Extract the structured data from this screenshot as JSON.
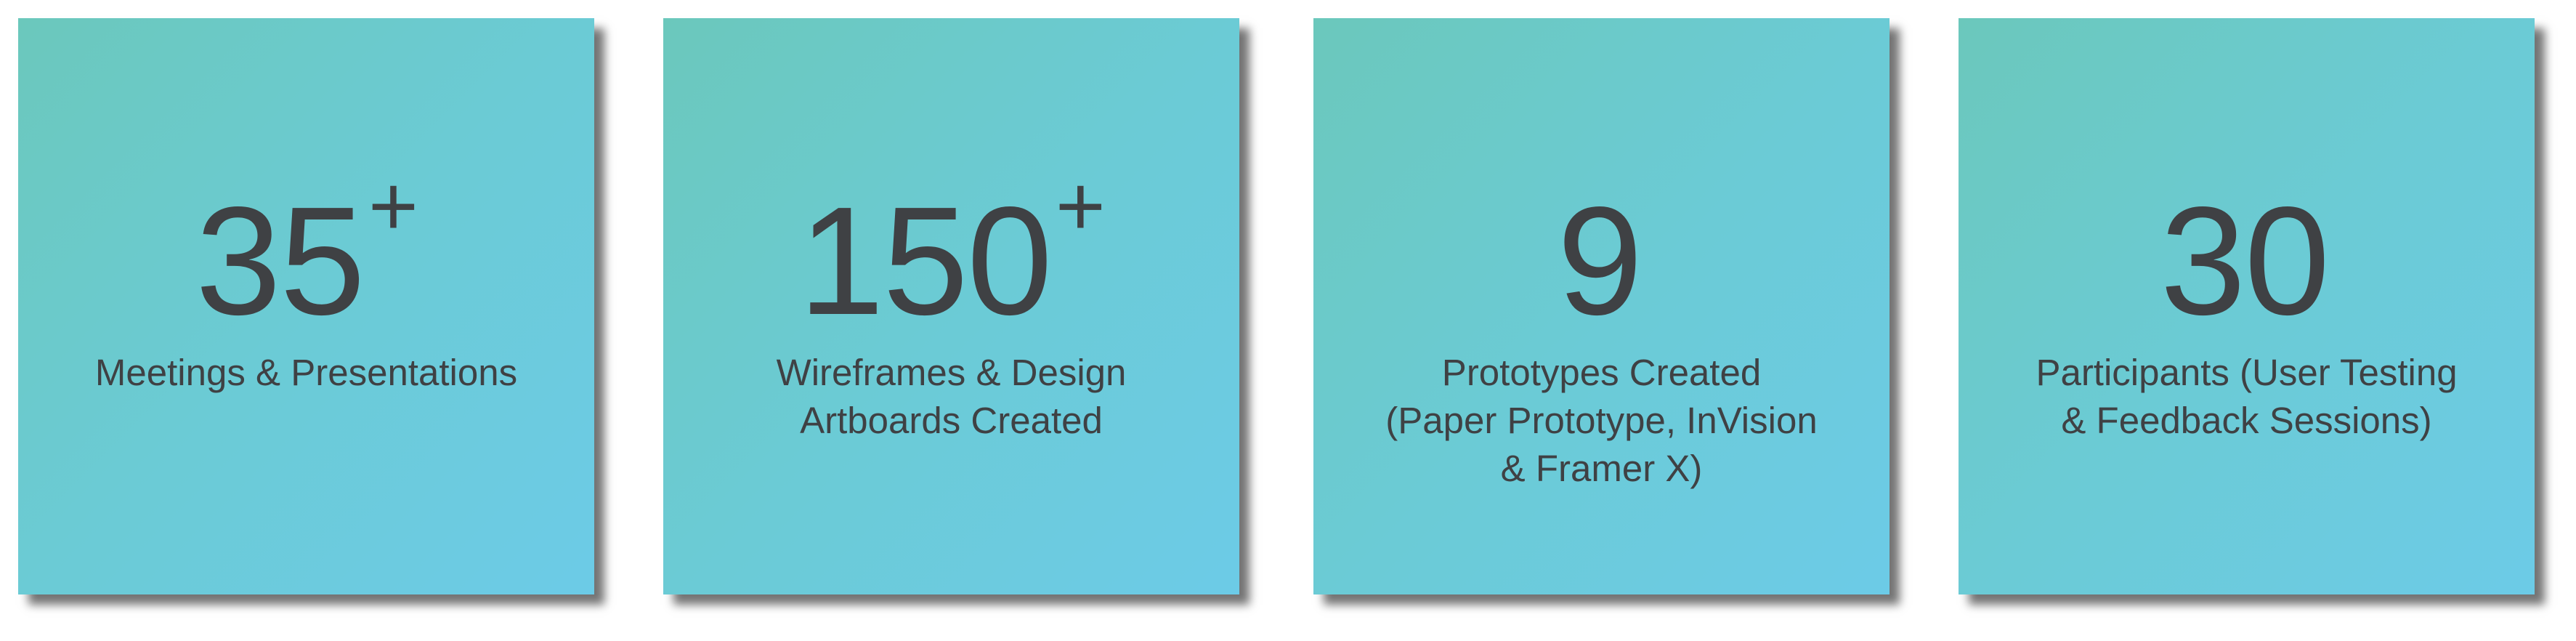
{
  "cards": [
    {
      "number": "35",
      "suffix": "+",
      "label": "Meetings & Presentations"
    },
    {
      "number": "150",
      "suffix": "+",
      "label": "Wireframes & Design\nArtboards Created"
    },
    {
      "number": "9",
      "suffix": "",
      "label": "Prototypes Created\n(Paper Prototype, InVision\n& Framer X)"
    },
    {
      "number": "30",
      "suffix": "",
      "label": "Participants (User Testing\n& Feedback Sessions)"
    }
  ],
  "colors": {
    "gradient_start": "#6bc8bc",
    "gradient_end": "#6ccbe7",
    "text": "#3f4144"
  }
}
